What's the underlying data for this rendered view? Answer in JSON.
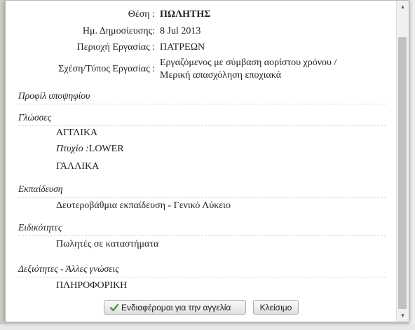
{
  "job": {
    "rows": [
      {
        "label": "Θέση :",
        "value": "ΠΩΛΗΤΗΣ"
      },
      {
        "label": "Ημ. Δημοσίευσης:",
        "value": "8 Jul 2013"
      },
      {
        "label": "Περιοχή Εργασίας :",
        "value": "ΠΑΤΡΕΩΝ"
      },
      {
        "label": "Σχέση/Τύπος Εργασίας :",
        "value_line1": "Εργαζόμενος με σύμβαση αορίστου χρόνου /",
        "value_line2": "Μερική απασχόληση εποχιακά"
      }
    ]
  },
  "profile": {
    "title": "Προφίλ υποψηφίου",
    "languages": {
      "title": "Γλώσσες",
      "lang1": "ΑΓΓΛΙΚΑ",
      "degree_label": "Πτυχίο :",
      "degree_value": "LOWER",
      "lang2": "ΓΑΛΛΙΚΑ"
    },
    "education": {
      "title": "Εκπαίδευση",
      "value": "Δευτεροβάθμια εκπαίδευση - Γενικό Λύκειο"
    },
    "specialties": {
      "title": "Ειδικότητες",
      "value": "Πωλητές σε καταστήματα"
    },
    "skills": {
      "title": "Δεξιότητες - Άλλες γνώσεις",
      "value": "ΠΛΗΡΟΦΟΡΙΚΗ"
    }
  },
  "buttons": {
    "interested": "Ενδιαφέρομαι για την αγγελία",
    "close": "Κλείσιμο"
  },
  "colors": {
    "check": "#3aa13a"
  }
}
